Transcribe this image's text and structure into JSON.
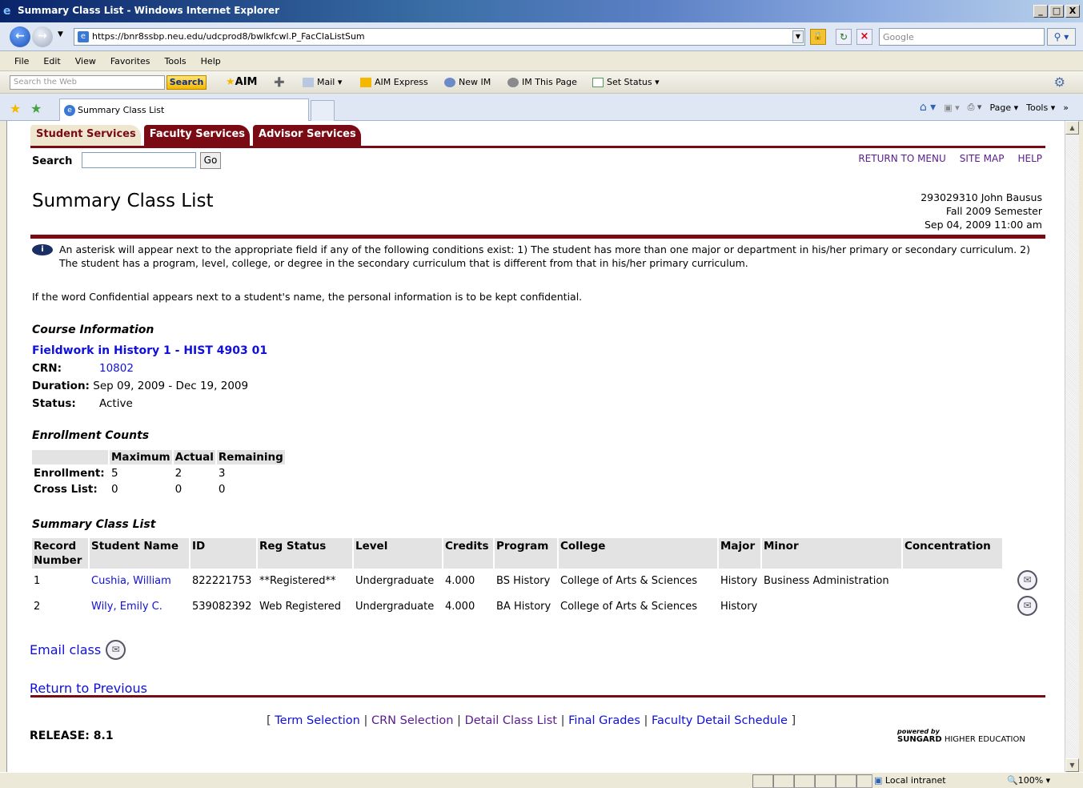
{
  "window": {
    "title": "Summary Class List - Windows Internet Explorer",
    "controls": [
      "_",
      "□",
      "X"
    ]
  },
  "address_bar": {
    "url": "https://bnr8ssbp.neu.edu/udcprod8/bwlkfcwl.P_FacClaListSum",
    "search_placeholder": "Google"
  },
  "menu": [
    "File",
    "Edit",
    "View",
    "Favorites",
    "Tools",
    "Help"
  ],
  "aim_toolbar": {
    "search_placeholder": "Search the Web",
    "search_button": "Search",
    "aim_label": "AIM",
    "items": [
      "Mail",
      "AIM Express",
      "New IM",
      "IM This Page",
      "Set Status"
    ]
  },
  "tabs_bar": {
    "tab_title": "Summary Class List",
    "commands": [
      "Page",
      "Tools"
    ]
  },
  "page": {
    "top_tabs": [
      "Student Services",
      "Faculty Services",
      "Advisor Services"
    ],
    "search_label": "Search",
    "go_label": "Go",
    "top_links": [
      "RETURN TO MENU",
      "SITE MAP",
      "HELP"
    ],
    "title": "Summary Class List",
    "user_info": [
      "293029310 John Bausus",
      "Fall 2009 Semester",
      "Sep 04, 2009 11:00 am"
    ],
    "info_message": "An asterisk will appear next to the appropriate field if any of the following conditions exist: 1) The student has more than one major or department in his/her primary or secondary curriculum. 2) The student has a program, level, college, or degree in the secondary curriculum that is different from that in his/her primary curriculum.",
    "confidential_note": "If the word Confidential appears next to a student's name, the personal information is to be kept confidential.",
    "course_info": {
      "heading": "Course Information",
      "course_link": "Fieldwork in History 1 - HIST 4903 01",
      "crn_label": "CRN:",
      "crn_value": "10802",
      "duration_label": "Duration:",
      "duration_value": "Sep 09, 2009 - Dec 19, 2009",
      "status_label": "Status:",
      "status_value": "Active"
    },
    "enrollment": {
      "heading": "Enrollment Counts",
      "columns": [
        "Maximum",
        "Actual",
        "Remaining"
      ],
      "rows": [
        {
          "label": "Enrollment:",
          "values": [
            "5",
            "2",
            "3"
          ]
        },
        {
          "label": "Cross List:",
          "values": [
            "0",
            "0",
            "0"
          ]
        }
      ]
    },
    "summary": {
      "heading": "Summary Class List",
      "columns": [
        "Record Number",
        "Student Name",
        "ID",
        "Reg Status",
        "Level",
        "Credits",
        "Program",
        "College",
        "Major",
        "Minor",
        "Concentration"
      ],
      "rows": [
        {
          "record": "1",
          "name": "Cushia, William",
          "id": "822221753",
          "reg_status": "**Registered**",
          "level": "Undergraduate",
          "credits": "4.000",
          "program": "BS History",
          "college": "College of Arts & Sciences",
          "major": "History",
          "minor": "Business Administration",
          "concentration": ""
        },
        {
          "record": "2",
          "name": "Wily, Emily C.",
          "id": "539082392",
          "reg_status": "Web Registered",
          "level": "Undergraduate",
          "credits": "4.000",
          "program": "BA History",
          "college": "College of Arts & Sciences",
          "major": "History",
          "minor": "",
          "concentration": ""
        }
      ]
    },
    "email_class": "Email class",
    "return_previous": "Return to Previous",
    "footer_links": [
      "Term Selection",
      "CRN Selection",
      "Detail Class List",
      "Final Grades",
      "Faculty Detail Schedule"
    ],
    "release": "RELEASE: 8.1",
    "powered_by": "powered by",
    "brand_bold": "SUNGARD",
    "brand_rest": "HIGHER EDUCATION"
  },
  "status_bar": {
    "zone": "Local intranet",
    "zoom": "100%"
  }
}
